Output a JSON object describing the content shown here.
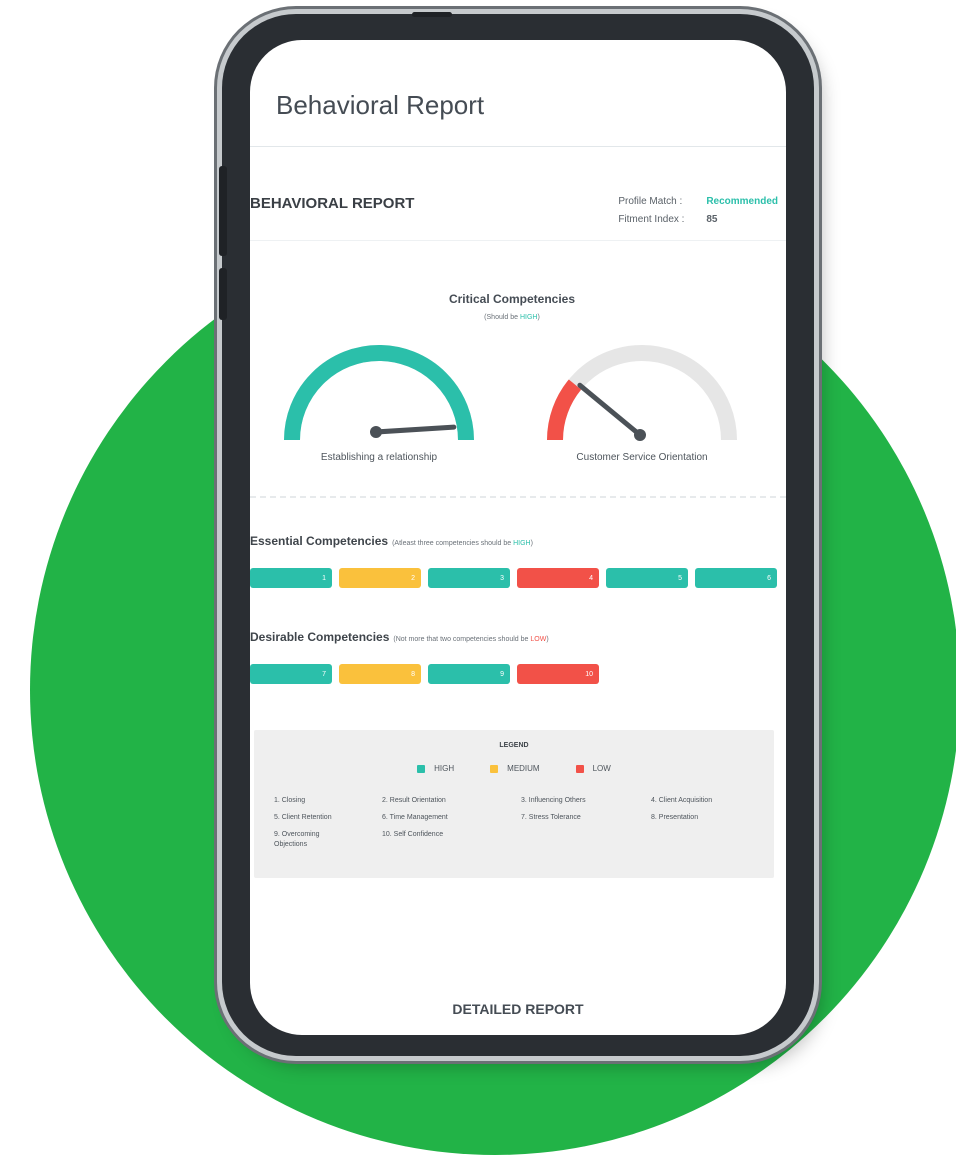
{
  "colors": {
    "green_bg": "#22b347",
    "high": "#2bbfaa",
    "medium": "#fac13c",
    "low": "#f25148",
    "gauge_track": "#e6e6e6"
  },
  "app": {
    "title": "Behavioral Report"
  },
  "report": {
    "heading": "BEHAVIORAL REPORT",
    "profile_match_label": "Profile Match :",
    "profile_match_value": "Recommended",
    "fitment_label": "Fitment Index :",
    "fitment_value": "85"
  },
  "critical": {
    "title": "Critical Competencies",
    "note_prefix": "(Should be ",
    "note_emph": "HIGH",
    "note_suffix": ")",
    "gauges": [
      {
        "label": "Establishing a relationship",
        "level": "HIGH",
        "needle_fraction": 0.98
      },
      {
        "label": "Customer Service Orientation",
        "level": "LOW",
        "needle_fraction": 0.22
      }
    ]
  },
  "essential": {
    "title": "Essential Competencies",
    "note_prefix": "(Atleast three competencies should be ",
    "note_emph": "HIGH",
    "note_suffix": ")",
    "bars": [
      {
        "label": "1",
        "level": "HIGH"
      },
      {
        "label": "2",
        "level": "MEDIUM"
      },
      {
        "label": "3",
        "level": "HIGH"
      },
      {
        "label": "4",
        "level": "LOW"
      },
      {
        "label": "5",
        "level": "HIGH"
      },
      {
        "label": "6",
        "level": "HIGH"
      }
    ]
  },
  "desirable": {
    "title": "Desirable Competencies",
    "note_prefix": "(Not more that two competencies should be ",
    "note_emph": "LOW",
    "note_suffix": ")",
    "bars": [
      {
        "label": "7",
        "level": "HIGH"
      },
      {
        "label": "8",
        "level": "MEDIUM"
      },
      {
        "label": "9",
        "level": "HIGH"
      },
      {
        "label": "10",
        "level": "LOW"
      }
    ]
  },
  "legend": {
    "title": "LEGEND",
    "high": "HIGH",
    "medium": "MEDIUM",
    "low": "LOW",
    "items": [
      "1. Closing",
      "2. Result Orientation",
      "3. Influencing Others",
      "4. Client Acquisition",
      "5. Client Retention",
      "6. Time Management",
      "7. Stress Tolerance",
      "8. Presentation",
      "9. Overcoming Objections",
      "10. Self Confidence"
    ]
  },
  "footer": {
    "detailed_report": "DETAILED REPORT"
  }
}
